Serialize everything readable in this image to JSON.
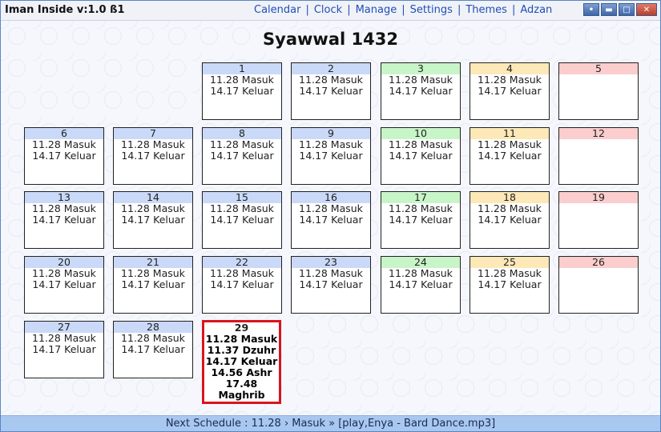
{
  "app_title": "Iman Inside v:1.0 ß1",
  "menu": [
    "Calendar",
    "Clock",
    "Manage",
    "Settings",
    "Themes",
    "Adzan"
  ],
  "window_buttons": [
    "pin-icon",
    "minimize-icon",
    "maximize-icon",
    "close-icon"
  ],
  "month_title": "Syawwal 1432",
  "default_lines": [
    "11.28 Masuk",
    "14.17 Keluar"
  ],
  "weeks": [
    [
      null,
      null,
      {
        "day": "1",
        "kind": "normal"
      },
      {
        "day": "2",
        "kind": "normal"
      },
      {
        "day": "3",
        "kind": "fri"
      },
      {
        "day": "4",
        "kind": "sat"
      },
      {
        "day": "5",
        "kind": "sun"
      }
    ],
    [
      {
        "day": "6",
        "kind": "normal"
      },
      {
        "day": "7",
        "kind": "normal"
      },
      {
        "day": "8",
        "kind": "normal"
      },
      {
        "day": "9",
        "kind": "normal"
      },
      {
        "day": "10",
        "kind": "fri"
      },
      {
        "day": "11",
        "kind": "sat"
      },
      {
        "day": "12",
        "kind": "sun"
      }
    ],
    [
      {
        "day": "13",
        "kind": "normal"
      },
      {
        "day": "14",
        "kind": "normal"
      },
      {
        "day": "15",
        "kind": "normal"
      },
      {
        "day": "16",
        "kind": "normal"
      },
      {
        "day": "17",
        "kind": "fri"
      },
      {
        "day": "18",
        "kind": "sat"
      },
      {
        "day": "19",
        "kind": "sun"
      }
    ],
    [
      {
        "day": "20",
        "kind": "normal"
      },
      {
        "day": "21",
        "kind": "normal"
      },
      {
        "day": "22",
        "kind": "normal"
      },
      {
        "day": "23",
        "kind": "normal"
      },
      {
        "day": "24",
        "kind": "fri"
      },
      {
        "day": "25",
        "kind": "sat"
      },
      {
        "day": "26",
        "kind": "sun"
      }
    ],
    [
      {
        "day": "27",
        "kind": "normal"
      },
      {
        "day": "28",
        "kind": "normal"
      },
      {
        "day": "29",
        "kind": "today",
        "lines": [
          "11.28 Masuk",
          "11.37 Dzuhr",
          "14.17 Keluar",
          "14.56 Ashr",
          "17.48",
          "Maghrib"
        ]
      },
      null,
      null,
      null,
      null
    ]
  ],
  "status_text": "Next Schedule : 11.28 › Masuk » [play,Enya - Bard Dance.mp3]",
  "colors": {
    "header_normal": "#cad9f7",
    "header_fri": "#c8f5c8",
    "header_sat": "#fde8b8",
    "header_sun": "#fbcdcd",
    "today_border": "#d9141e",
    "link": "#1f4fb8"
  }
}
